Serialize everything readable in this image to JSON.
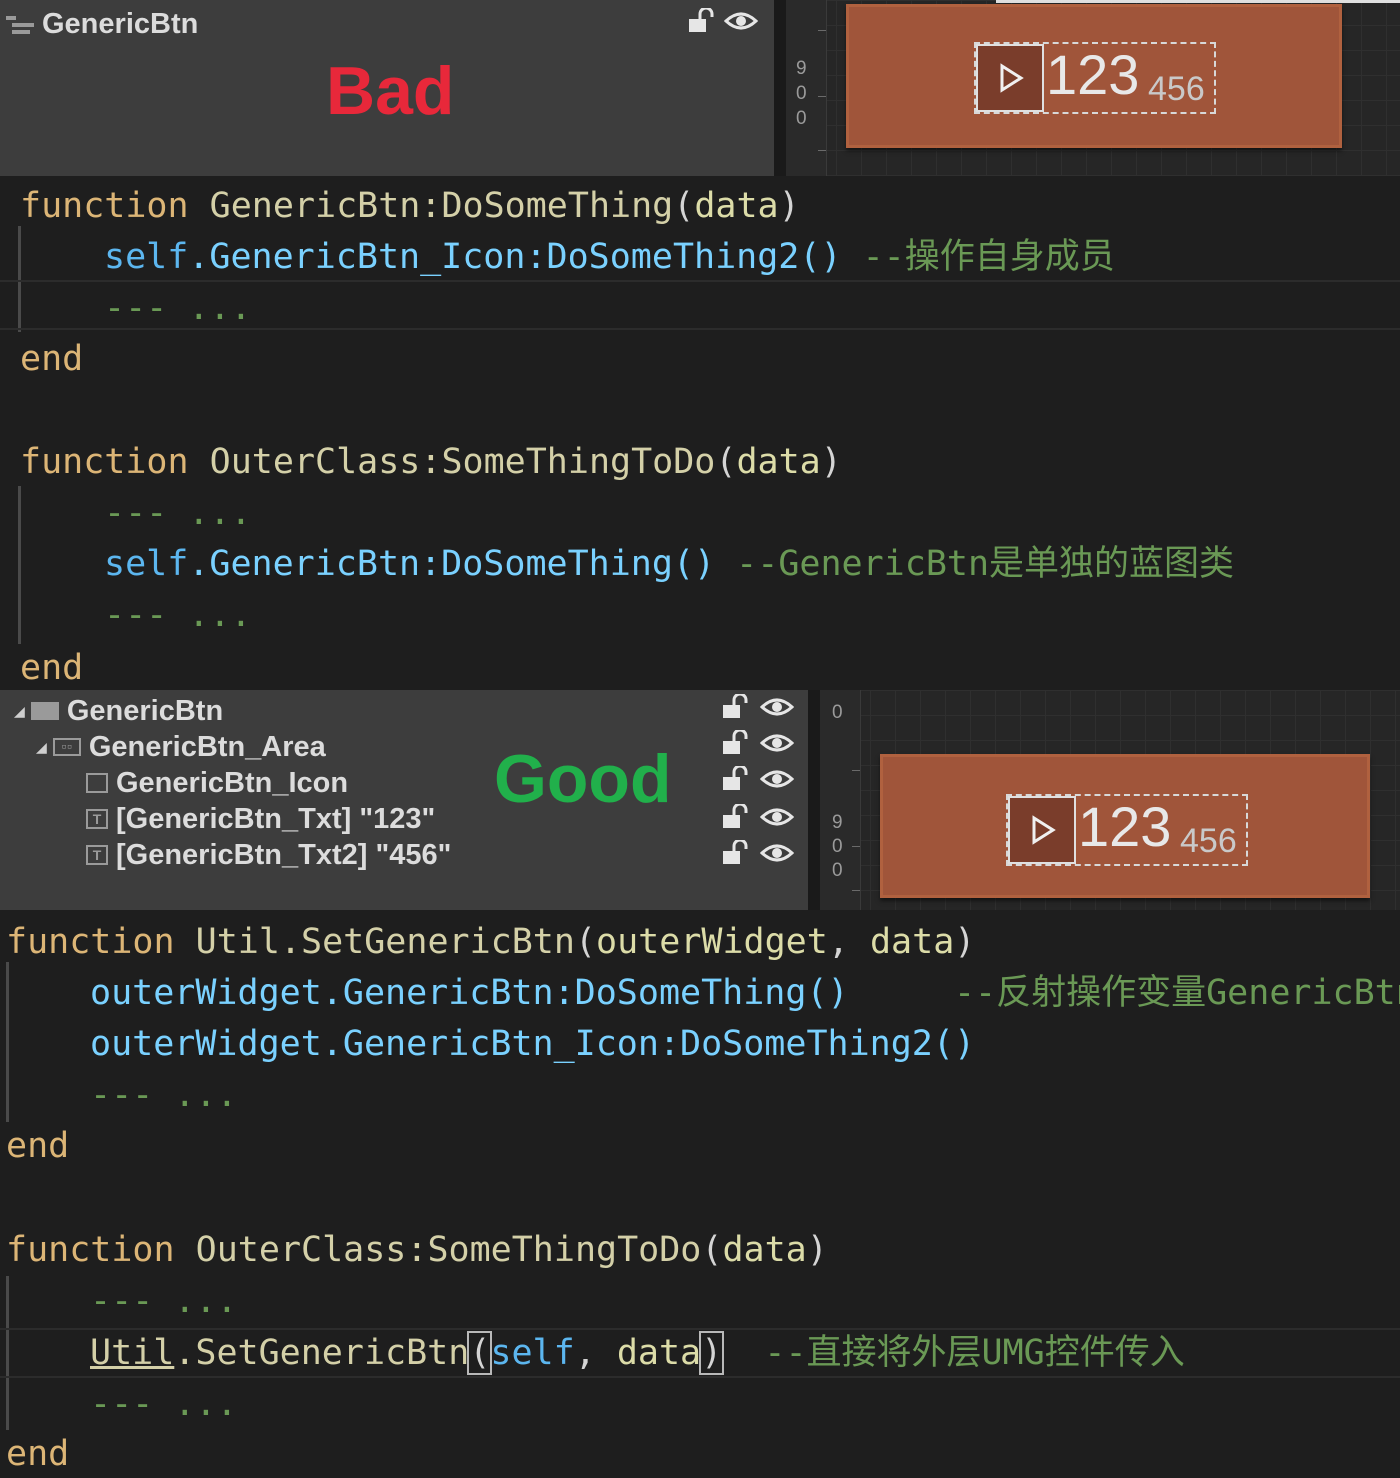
{
  "top_panel": {
    "hierarchy_root": "GenericBtn",
    "verdict": "Bad",
    "ruler_digits": [
      "9",
      "0",
      "0"
    ],
    "button_primary_text": "123",
    "button_secondary_text": "456"
  },
  "code_bad": {
    "f1_kw": "function",
    "f1_name": "GenericBtn:DoSomeThing",
    "f1_open": "(",
    "f1_param": "data",
    "f1_close": ")",
    "f1_l1_self": "self",
    "f1_l1_rest": ".GenericBtn_Icon:DoSomeThing2()",
    "f1_l1_comment": "--操作自身成员",
    "f1_l2": "--- ...",
    "f1_end": "end",
    "f2_kw": "function",
    "f2_name": "OuterClass:SomeThingToDo",
    "f2_open": "(",
    "f2_param": "data",
    "f2_close": ")",
    "f2_l1": "--- ...",
    "f2_l2_self": "self",
    "f2_l2_rest": ".GenericBtn:DoSomeThing()",
    "f2_l2_comment": "--GenericBtn是单独的蓝图类",
    "f2_l3": "--- ...",
    "f2_end": "end"
  },
  "mid_panel": {
    "tree": [
      {
        "label": "GenericBtn",
        "icon": "canvas-icon"
      },
      {
        "label": "GenericBtn_Area",
        "icon": "overlay-icon"
      },
      {
        "label": "GenericBtn_Icon",
        "icon": "image-icon"
      },
      {
        "label": "[GenericBtn_Txt] \"123\"",
        "icon": "text-icon"
      },
      {
        "label": "[GenericBtn_Txt2] \"456\"",
        "icon": "text-icon"
      }
    ],
    "verdict": "Good",
    "ruler_digits": [
      "0",
      "9",
      "0",
      "0"
    ],
    "button_primary_text": "123",
    "button_secondary_text": "456"
  },
  "code_good": {
    "f3_kw": "function",
    "f3_name": "Util.SetGenericBtn",
    "f3_open": "(",
    "f3_param1": "outerWidget",
    "f3_comma": ", ",
    "f3_param2": "data",
    "f3_close": ")",
    "f3_l1_var": "outerWidget",
    "f3_l1_rest": ".GenericBtn:DoSomeThing()",
    "f3_l1_comment": "--反射操作变量GenericBtn",
    "f3_l2_var": "outerWidget",
    "f3_l2_rest": ".GenericBtn_Icon:DoSomeThing2()",
    "f3_l3": "--- ...",
    "f3_end": "end",
    "f4_kw": "function",
    "f4_name": "OuterClass:SomeThingToDo",
    "f4_open": "(",
    "f4_param": "data",
    "f4_close": ")",
    "f4_l1": "--- ...",
    "f4_l2_util": "Util",
    "f4_l2_fn": ".SetGenericBtn",
    "f4_l2_open": "(",
    "f4_l2_self": "self",
    "f4_l2_comma": ", ",
    "f4_l2_data": "data",
    "f4_l2_close": ")",
    "f4_l2_comment": "--直接将外层UMG控件传入",
    "f4_l3": "--- ...",
    "f4_end": "end"
  },
  "colors": {
    "keyword": "#dcb576",
    "self": "#5cb6ef",
    "comment": "#6a9955",
    "bad": "#e8283a",
    "good": "#21b04b",
    "button_bg": "#a0553a"
  }
}
